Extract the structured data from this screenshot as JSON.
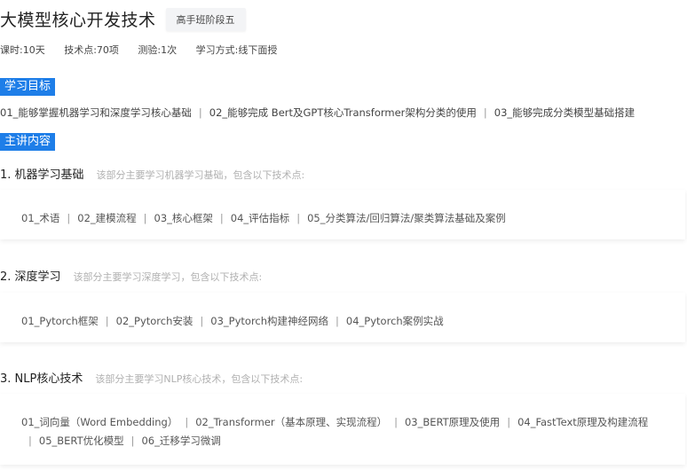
{
  "header": {
    "title": "大模型核心开发技术",
    "badge": "高手班阶段五"
  },
  "meta": {
    "hours": "课时:10天",
    "points": "技术点:70项",
    "tests": "测验:1次",
    "mode": "学习方式:线下面授"
  },
  "goals": {
    "tag": "学习目标",
    "separator": "|",
    "items": [
      "01_能够掌握机器学习和深度学习核心基础",
      "02_能够完成 Bert及GPT核心Transformer架构分类的使用",
      "03_能够完成分类模型基础搭建"
    ]
  },
  "content": {
    "tag": "主讲内容",
    "modules": [
      {
        "title": "1. 机器学习基础",
        "desc": "该部分主要学习机器学习基础，包含以下技术点:",
        "topics": [
          "01_术语",
          "02_建模流程",
          "03_核心框架",
          "04_评估指标",
          "05_分类算法/回归算法/聚类算法基础及案例"
        ]
      },
      {
        "title": "2. 深度学习",
        "desc": "该部分主要学习深度学习，包含以下技术点:",
        "topics": [
          "01_Pytorch框架",
          "02_Pytorch安装",
          "03_Pytorch构建神经网络",
          "04_Pytorch案例实战"
        ]
      },
      {
        "title": "3. NLP核心技术",
        "desc": "该部分主要学习NLP核心技术，包含以下技术点:",
        "topics": [
          "01_词向量（Word Embedding）",
          "02_Transformer（基本原理、实现流程）",
          "03_BERT原理及使用",
          "04_FastText原理及构建流程",
          "05_BERT优化模型",
          "06_迁移学习微调"
        ]
      }
    ]
  },
  "colors": {
    "accent": "#1e7ee8",
    "muted_text": "#b0b0b0"
  }
}
